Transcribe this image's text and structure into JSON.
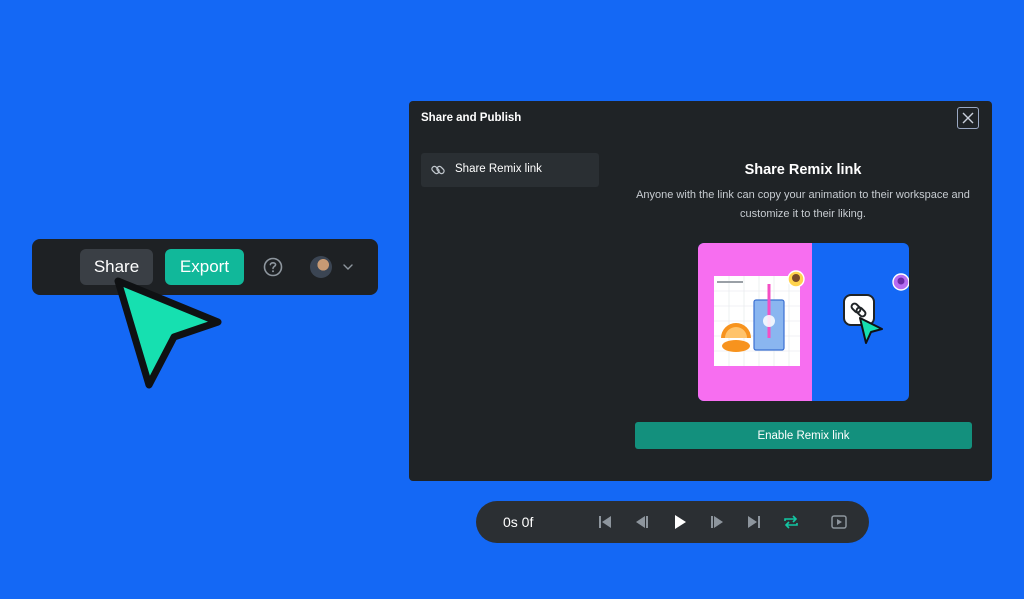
{
  "toolbar": {
    "share_label": "Share",
    "export_label": "Export",
    "help_icon": "question-circle-icon",
    "avatar_icon": "user-avatar",
    "chevron_icon": "chevron-down-icon"
  },
  "modal": {
    "title": "Share and Publish",
    "close_icon": "close-icon",
    "sidebar": {
      "items": [
        {
          "label": "Share Remix link",
          "icon": "link-icon",
          "selected": true
        }
      ]
    },
    "panel": {
      "heading": "Share Remix link",
      "description": "Anyone with the link can copy your animation to their workspace and customize it to their liking.",
      "illustration": "remix-illustration",
      "button_label": "Enable Remix link"
    }
  },
  "playback": {
    "time": "0s 0f",
    "controls": [
      "skip-to-start-icon",
      "step-back-icon",
      "play-icon",
      "step-forward-icon",
      "skip-to-end-icon",
      "loop-icon",
      "preview-icon"
    ]
  },
  "colors": {
    "background": "#1468f5",
    "panel": "#1f2326",
    "accent": "#11b89a",
    "cursor": "#16e0b0"
  }
}
